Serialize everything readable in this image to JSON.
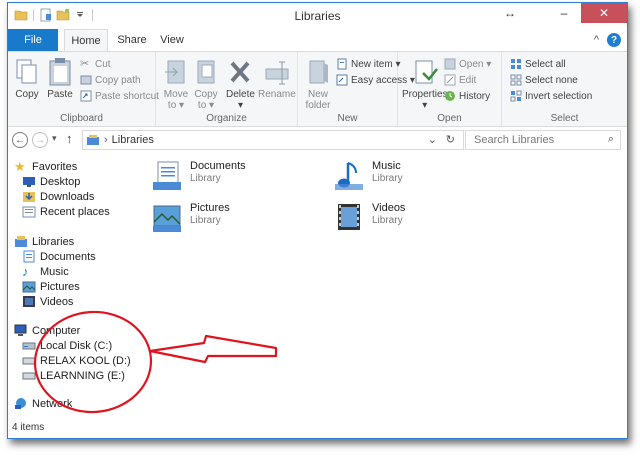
{
  "window": {
    "title": "Libraries"
  },
  "titlebar": {
    "resize_glyph": "↔",
    "minimize": "–",
    "maximize": "☐",
    "close": "✕"
  },
  "ribbon_tabs": {
    "file": "File",
    "home": "Home",
    "share": "Share",
    "view": "View",
    "collapse": "^",
    "help": "?"
  },
  "ribbon": {
    "clipboard": {
      "label": "Clipboard",
      "copy": "Copy",
      "paste": "Paste",
      "cut": "Cut",
      "copy_path": "Copy path",
      "paste_shortcut": "Paste shortcut"
    },
    "organize": {
      "label": "Organize",
      "move_to": "Move",
      "move_to2": "to ▾",
      "copy_to": "Copy",
      "copy_to2": "to ▾",
      "delete": "Delete",
      "delete2": "▾",
      "rename": "Rename"
    },
    "new": {
      "label": "New",
      "new_folder": "New",
      "new_folder2": "folder",
      "new_item": "New item ▾",
      "easy_access": "Easy access ▾"
    },
    "open": {
      "label": "Open",
      "properties": "Properties",
      "properties2": "▾",
      "open": "Open ▾",
      "edit": "Edit",
      "history": "History"
    },
    "select": {
      "label": "Select",
      "select_all": "Select all",
      "select_none": "Select none",
      "invert": "Invert selection"
    }
  },
  "address": {
    "back": "←",
    "forward": "→",
    "recent": "▾",
    "up": "↑",
    "path_sep": "›",
    "path": "Libraries",
    "dropdown": "⌄",
    "refresh": "↻",
    "search_placeholder": "Search Libraries",
    "search_icon": "⌕"
  },
  "nav": {
    "favorites": "Favorites",
    "desktop": "Desktop",
    "downloads": "Downloads",
    "recent_places": "Recent places",
    "libraries": "Libraries",
    "documents": "Documents",
    "music": "Music",
    "pictures": "Pictures",
    "videos": "Videos",
    "computer": "Computer",
    "local_disk": "Local Disk (C:)",
    "relax_kool": "RELAX KOOL (D:)",
    "learnning": "LEARNNING (E:)",
    "network": "Network"
  },
  "content": {
    "items": [
      {
        "name": "Documents",
        "type": "Library"
      },
      {
        "name": "Music",
        "type": "Library"
      },
      {
        "name": "Pictures",
        "type": "Library"
      },
      {
        "name": "Videos",
        "type": "Library"
      }
    ]
  },
  "status": {
    "count": "4 items"
  },
  "colors": {
    "accent": "#1979ca",
    "annotation": "#e0141e",
    "close_button": "#c7505b"
  }
}
